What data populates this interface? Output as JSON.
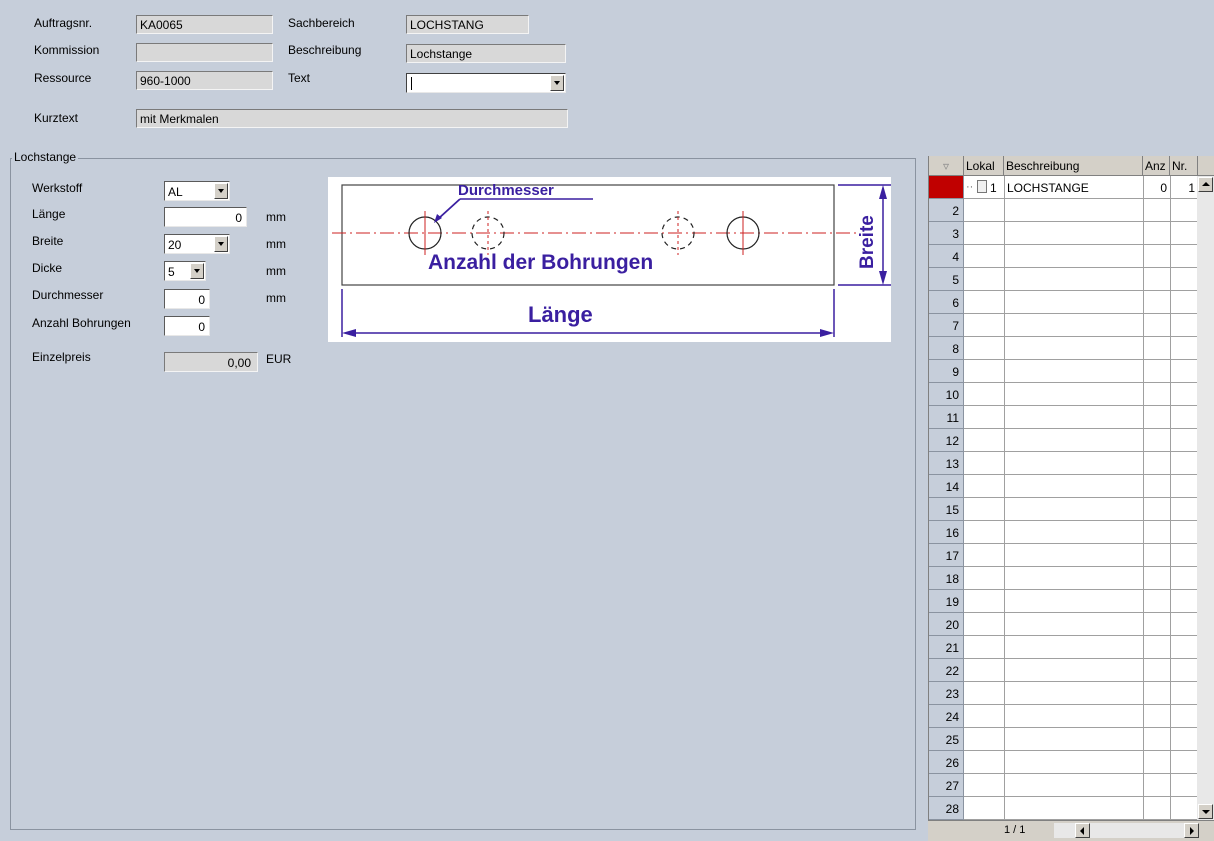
{
  "header": {
    "auftragsnr": {
      "label": "Auftragsnr.",
      "value": "KA0065"
    },
    "kommission": {
      "label": "Kommission",
      "value": ""
    },
    "ressource": {
      "label": "Ressource",
      "value": "960-1000"
    },
    "sachbereich": {
      "label": "Sachbereich",
      "value": "LOCHSTANG"
    },
    "beschreibung": {
      "label": "Beschreibung",
      "value": "Lochstange"
    },
    "text": {
      "label": "Text",
      "value": ""
    },
    "kurztext": {
      "label": "Kurztext",
      "value": "mit Merkmalen"
    }
  },
  "group": {
    "title": "Lochstange",
    "werkstoff": {
      "label": "Werkstoff",
      "value": "AL"
    },
    "laenge": {
      "label": "Länge",
      "value": "0",
      "unit": "mm"
    },
    "breite": {
      "label": "Breite",
      "value": "20",
      "unit": "mm"
    },
    "dicke": {
      "label": "Dicke",
      "value": "5",
      "unit": "mm"
    },
    "durchmesser": {
      "label": "Durchmesser",
      "value": "0",
      "unit": "mm"
    },
    "anzahl": {
      "label": "Anzahl Bohrungen",
      "value": "0"
    },
    "einzelpreis": {
      "label": "Einzelpreis",
      "value": "0,00",
      "unit": "EUR"
    }
  },
  "diagram": {
    "durchmesser": "Durchmesser",
    "anzahl": "Anzahl der Bohrungen",
    "laenge": "Länge",
    "breite": "Breite",
    "color": "#3a1fa0"
  },
  "grid": {
    "columns": [
      "Lokal",
      "Beschreibung",
      "Anz",
      "Nr."
    ],
    "rows": [
      {
        "num": "1",
        "lokal": "1",
        "beschreibung": "LOCHSTANGE",
        "anz": "0",
        "nr": "1"
      },
      {
        "num": "2"
      },
      {
        "num": "3"
      },
      {
        "num": "4"
      },
      {
        "num": "5"
      },
      {
        "num": "6"
      },
      {
        "num": "7"
      },
      {
        "num": "8"
      },
      {
        "num": "9"
      },
      {
        "num": "10"
      },
      {
        "num": "11"
      },
      {
        "num": "12"
      },
      {
        "num": "13"
      },
      {
        "num": "14"
      },
      {
        "num": "15"
      },
      {
        "num": "16"
      },
      {
        "num": "17"
      },
      {
        "num": "18"
      },
      {
        "num": "19"
      },
      {
        "num": "20"
      },
      {
        "num": "21"
      },
      {
        "num": "22"
      },
      {
        "num": "23"
      },
      {
        "num": "24"
      },
      {
        "num": "25"
      },
      {
        "num": "26"
      },
      {
        "num": "27"
      },
      {
        "num": "28"
      }
    ],
    "page": "1 / 1"
  }
}
